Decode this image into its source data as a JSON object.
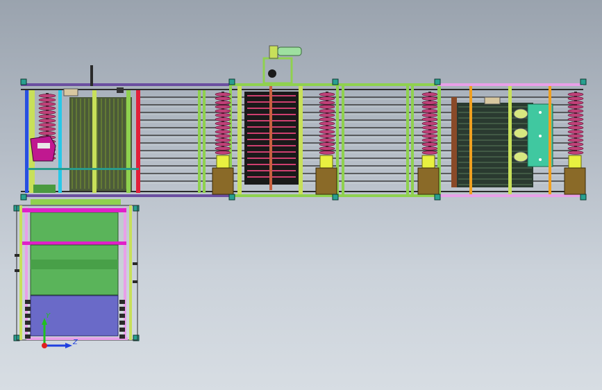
{
  "viewport": {
    "background_top": "#9aa3ae",
    "background_bottom": "#d7dde3"
  },
  "colors": {
    "frame_green": "#8fd14f",
    "frame_yellow": "#c8e05a",
    "purple": "#6b4fa0",
    "magenta": "#e020c8",
    "pink": "#e890d8",
    "red": "#e0203a",
    "blue": "#2850e0",
    "cyan": "#28c8e8",
    "coil": "#c04078",
    "module_tan": "#8a6a28",
    "module_yellow": "#e8f040",
    "panel_teal": "#40c8a0",
    "green_panel": "#5ab45a",
    "blue_panel": "#6a6ac8",
    "corner_teal": "#2aa090",
    "orange": "#f0a020",
    "dark": "#1a1a1a"
  },
  "triad": {
    "x_axis_color": "#e02020",
    "y_axis_color": "#20c020",
    "z_axis_color": "#2040e0",
    "y_label": "Y",
    "z_label": "Z"
  },
  "icons": {
    "triad": "axis-triad-icon",
    "corner_node": "corner-block-icon"
  }
}
